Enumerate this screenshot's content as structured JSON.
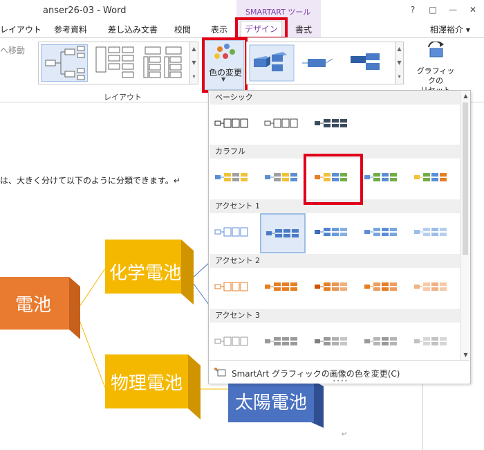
{
  "window": {
    "title": "anser26-03 - Word",
    "context_group": "SMARTART ツール",
    "help": "?",
    "restore": "□",
    "minimize": "—",
    "close": "✕"
  },
  "tabs": {
    "layout": "レイアウト",
    "references": "参考資料",
    "mailings": "差し込み文書",
    "review": "校閲",
    "view": "表示",
    "design": "デザイン",
    "format": "書式",
    "user": "相澤裕介 ▾"
  },
  "ribbon": {
    "move_label": "へ移動",
    "layout_group": "レイアウト",
    "color_change": "色の変更",
    "reset_graphic": "グラフィックの\nリセット"
  },
  "document": {
    "body_text": "は、大きく分けて以下のように分類できます。↵",
    "para_mark": "↵",
    "nodes": {
      "root": "電池",
      "chemical": "化学電池",
      "physical": "物理電池",
      "solar": "太陽電池"
    }
  },
  "dropdown": {
    "sections": [
      {
        "title": "ベーシック",
        "swatches": [
          {
            "colors": [
              "#1f1f1f",
              "#1f1f1f",
              "#1f1f1f",
              "#1f1f1f"
            ],
            "style": "outline"
          },
          {
            "colors": [
              "#404040",
              "#404040",
              "#404040",
              "#404040"
            ],
            "style": "outline"
          },
          {
            "colors": [
              "#3b4a5e",
              "#3b4a5e",
              "#3b4a5e",
              "#3b4a5e"
            ],
            "style": "fill"
          }
        ]
      },
      {
        "title": "カラフル",
        "swatches": [
          {
            "colors": [
              "#5b8ed6",
              "#f0c23b",
              "#a0a0a0",
              "#f0c23b"
            ],
            "style": "fill"
          },
          {
            "colors": [
              "#5b8ed6",
              "#a0a0a0",
              "#f0c23b",
              "#5b8ed6"
            ],
            "style": "fill"
          },
          {
            "colors": [
              "#e67e22",
              "#f0c23b",
              "#5b8ed6",
              "#70ad47"
            ],
            "style": "fill",
            "selected": true
          },
          {
            "colors": [
              "#5b8ed6",
              "#70ad47",
              "#5b8ed6",
              "#70ad47"
            ],
            "style": "fill"
          },
          {
            "colors": [
              "#f0c23b",
              "#70ad47",
              "#5b8ed6",
              "#e67e22"
            ],
            "style": "fill"
          }
        ]
      },
      {
        "title": "アクセント 1",
        "swatches": [
          {
            "colors": [
              "#5b8ed6",
              "#5b8ed6",
              "#5b8ed6",
              "#5b8ed6"
            ],
            "style": "outline"
          },
          {
            "colors": [
              "#4a7bc7",
              "#4a7bc7",
              "#4a7bc7",
              "#4a7bc7"
            ],
            "style": "fill",
            "hover": true
          },
          {
            "colors": [
              "#3b6fb8",
              "#4f86cf",
              "#6a9bdc",
              "#86afe3"
            ],
            "style": "fill"
          },
          {
            "colors": [
              "#5b8ed6",
              "#7aa6df",
              "#5b8ed6",
              "#7aa6df"
            ],
            "style": "fill"
          },
          {
            "colors": [
              "#9dbde8",
              "#b7cfee",
              "#9dbde8",
              "#b7cfee"
            ],
            "style": "fill"
          }
        ]
      },
      {
        "title": "アクセント 2",
        "swatches": [
          {
            "colors": [
              "#e67e22",
              "#e67e22",
              "#e67e22",
              "#e67e22"
            ],
            "style": "outline"
          },
          {
            "colors": [
              "#e67e22",
              "#e67e22",
              "#e67e22",
              "#e67e22"
            ],
            "style": "fill"
          },
          {
            "colors": [
              "#d35400",
              "#e67e22",
              "#eb9550",
              "#f0ae7b"
            ],
            "style": "fill"
          },
          {
            "colors": [
              "#e67e22",
              "#ef9d5e",
              "#e67e22",
              "#ef9d5e"
            ],
            "style": "fill"
          },
          {
            "colors": [
              "#f2b184",
              "#f6c9a8",
              "#f2b184",
              "#f6c9a8"
            ],
            "style": "fill"
          }
        ]
      },
      {
        "title": "アクセント 3",
        "swatches": [
          {
            "colors": [
              "#9a9a9a",
              "#9a9a9a",
              "#9a9a9a",
              "#9a9a9a"
            ],
            "style": "outline"
          },
          {
            "colors": [
              "#9a9a9a",
              "#9a9a9a",
              "#9a9a9a",
              "#9a9a9a"
            ],
            "style": "fill"
          },
          {
            "colors": [
              "#808080",
              "#999999",
              "#b0b0b0",
              "#c6c6c6"
            ],
            "style": "fill"
          },
          {
            "colors": [
              "#9a9a9a",
              "#b5b5b5",
              "#9a9a9a",
              "#b5b5b5"
            ],
            "style": "fill"
          },
          {
            "colors": [
              "#c2c2c2",
              "#d6d6d6",
              "#c2c2c2",
              "#d6d6d6"
            ],
            "style": "fill"
          }
        ]
      }
    ],
    "footer": "SmartArt グラフィックの画像の色を変更(C)",
    "grip": "••••"
  },
  "colors": {
    "accent_red": "#e0001a",
    "smartart_purple": "#7a3fa8",
    "orange": "#e87b2f",
    "yellow": "#f5b800",
    "blue": "#4a72c0"
  }
}
